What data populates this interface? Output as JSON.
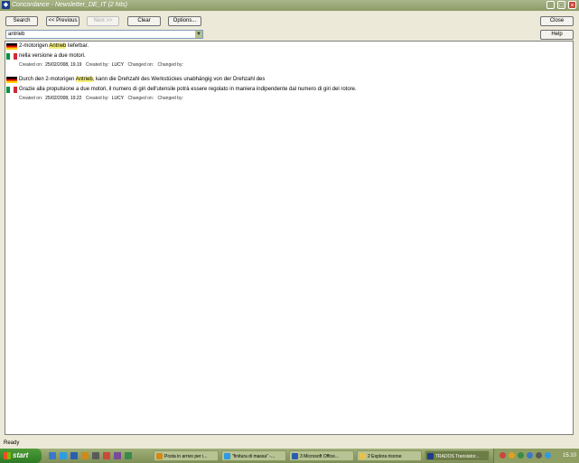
{
  "window": {
    "title": "Concordance - Newsletter_DE_IT (2 hits)"
  },
  "toolbar": {
    "search": "Search",
    "previous": "<< Previous",
    "next": "Next >>",
    "clear": "Clear",
    "options": "Options...",
    "close": "Close",
    "help": "Help"
  },
  "query": {
    "value": "antrieb"
  },
  "meta_labels": {
    "created_on": "Created on:",
    "created_by": "Created by:",
    "changed_on": "Changed on:",
    "changed_by": "Changed by:"
  },
  "hits": [
    {
      "source_pre": "2-motorigen ",
      "source_hl": "Antrieb",
      "source_post": " lieferbar.",
      "target": "nella versione a due motori.",
      "created_on": "25/02/2008, 19.19",
      "created_by": "LUCY"
    },
    {
      "source_pre": "Durch den 2-motorigen ",
      "source_hl": "Antrieb",
      "source_post": ", kann die Drehzahl des Werkstückes unabhängig von der Drehzahl des",
      "target": "Grazie alla propulsione a due motori, il numero di giri dell'utensile potrà essere regolato in maniera indipendente dal numero di giri del rotore.",
      "created_on": "25/02/2008, 19.22",
      "created_by": "LUCY"
    }
  ],
  "status": {
    "text": "Ready"
  },
  "taskbar": {
    "start": "start",
    "tasks": [
      "Posta in arrivo per i...",
      "\"finitura di massa\" -...",
      "3 Microsoft Office...",
      "2 Esplora risorse",
      "TRADOS Translator..."
    ],
    "clock": "15.10"
  }
}
